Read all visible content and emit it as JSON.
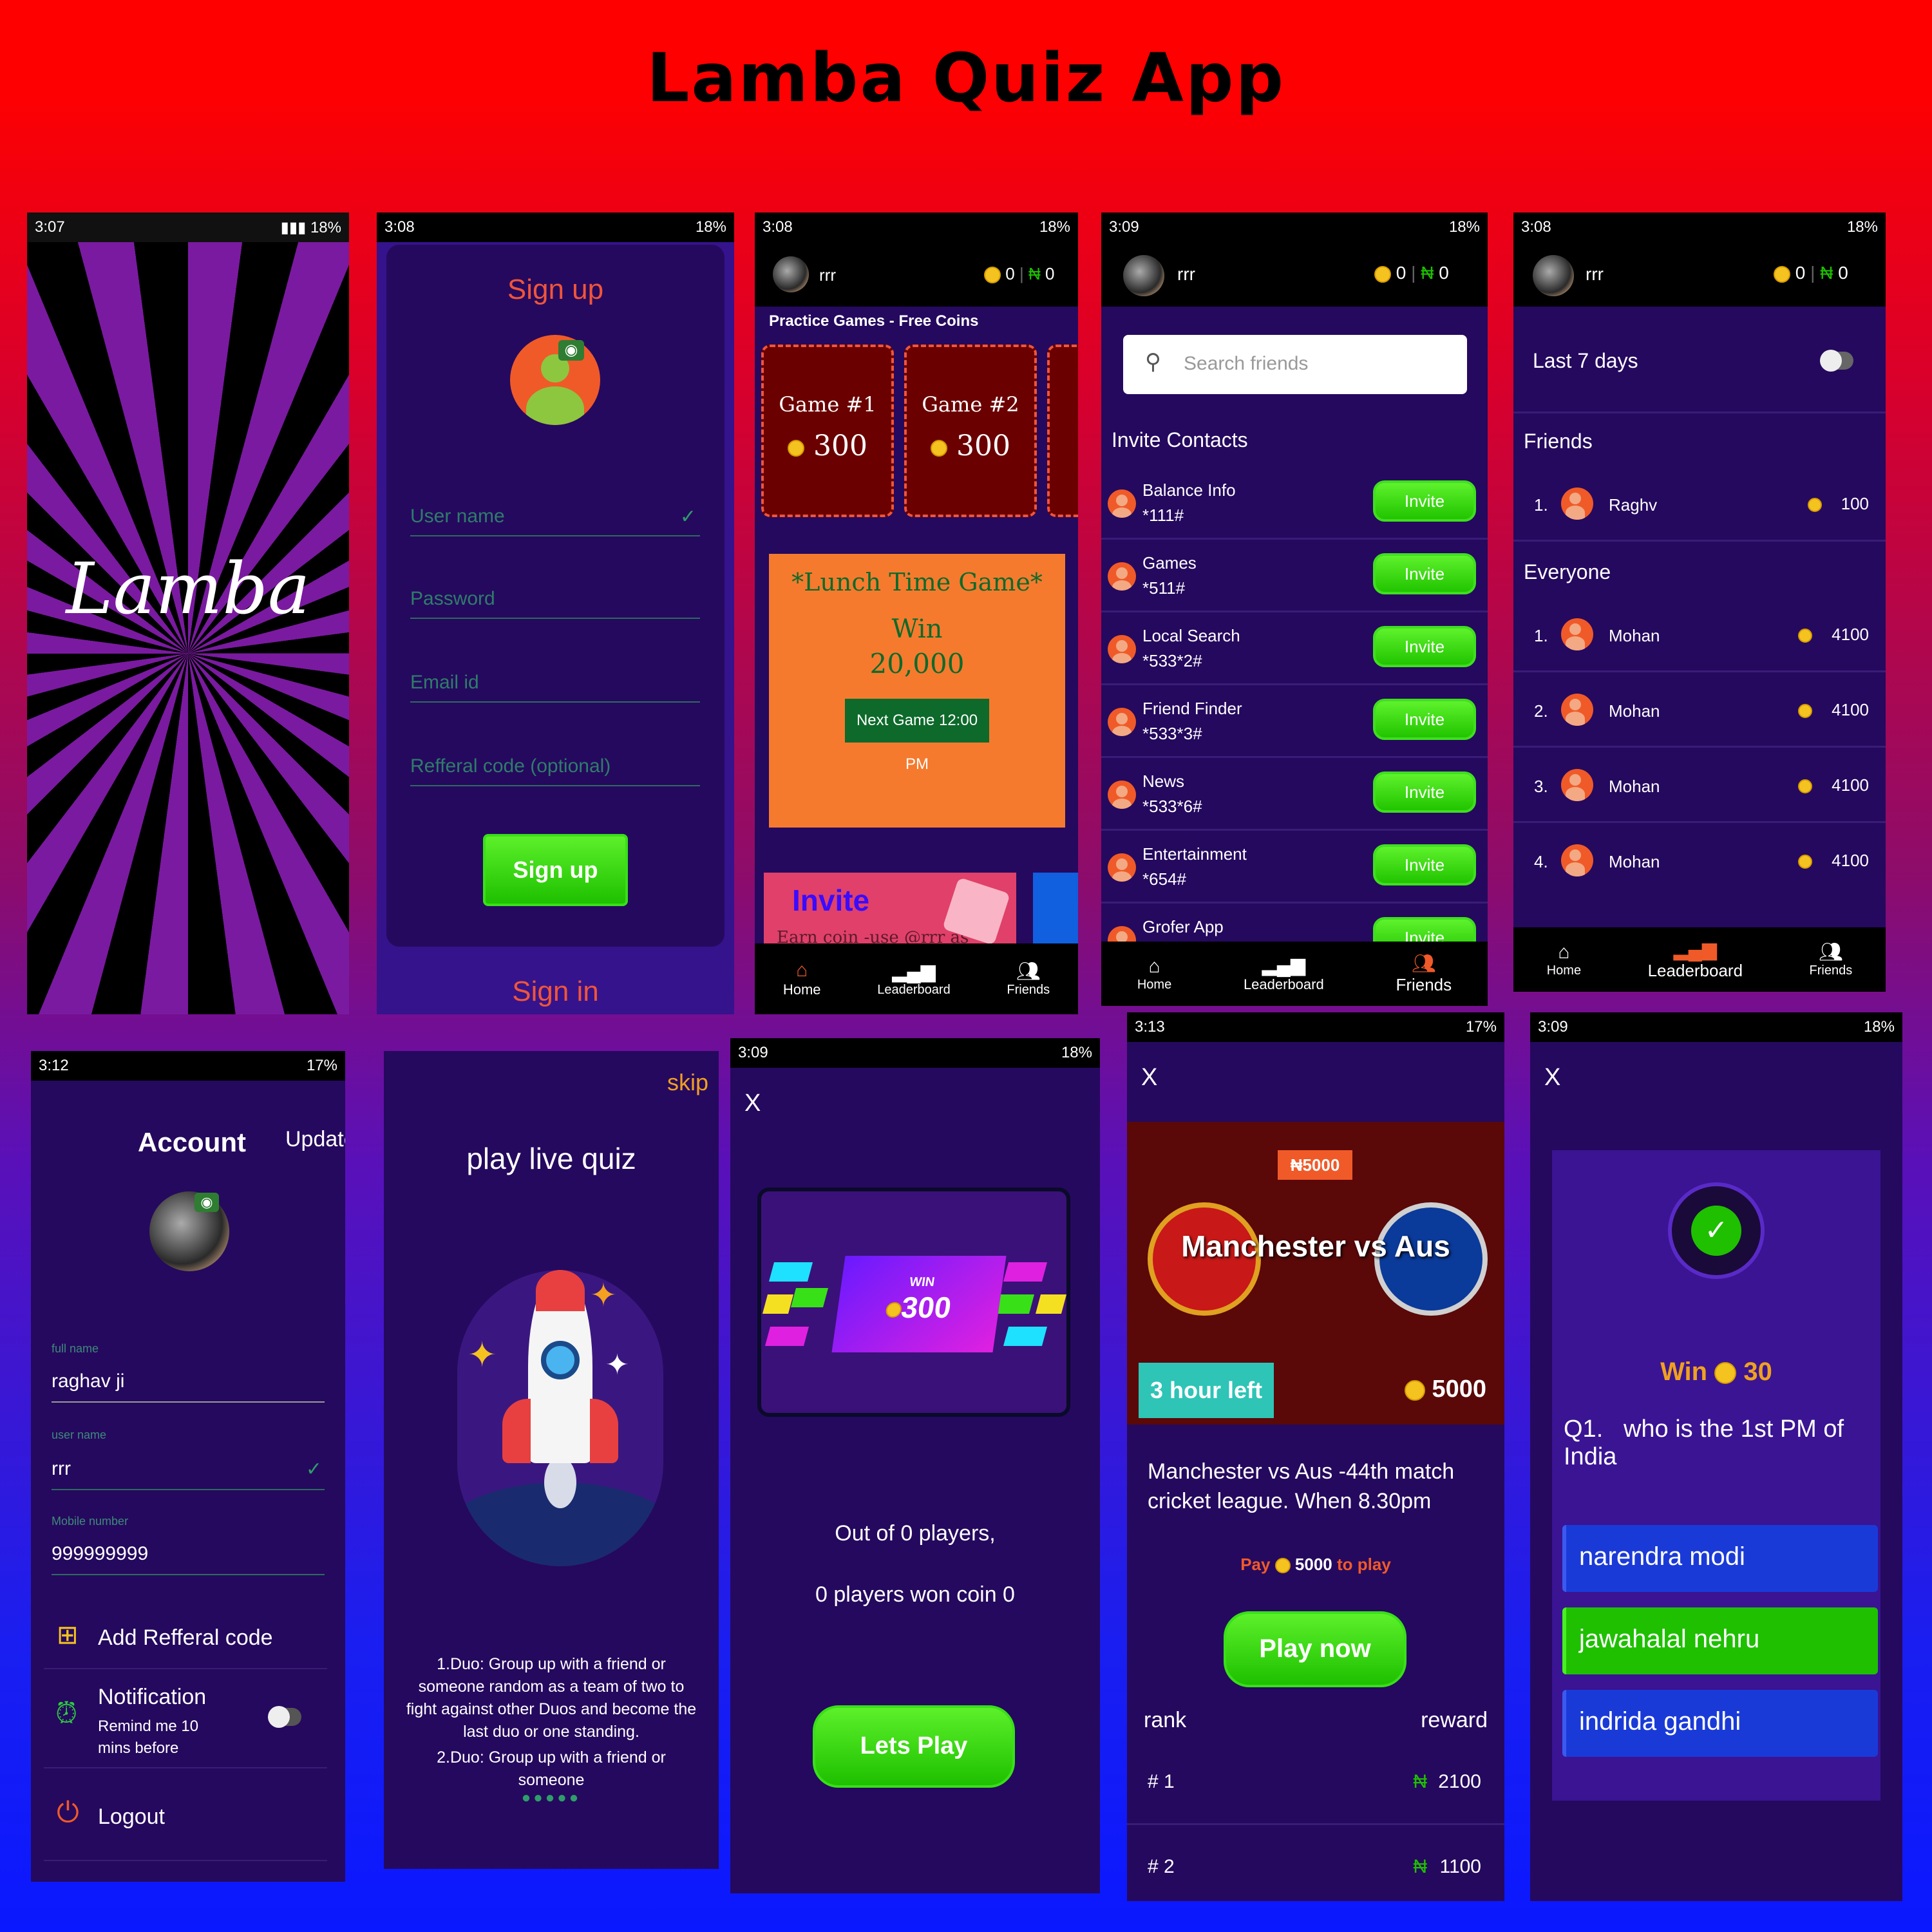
{
  "title": "Lamba Quiz App",
  "splash": {
    "time": "3:07",
    "battery": "18%",
    "logo": "Lamba"
  },
  "signup": {
    "time": "3:08",
    "battery": "18%",
    "heading": "Sign up",
    "username_ph": "User name",
    "password_ph": "Password",
    "email_ph": "Email id",
    "referral_ph": "Refferal code (optional)",
    "button": "Sign up",
    "signin": "Sign in"
  },
  "home": {
    "time": "3:08",
    "battery": "18%",
    "user": "rrr",
    "coins": "0",
    "naira": "0",
    "section": "Practice Games - Free Coins",
    "games": [
      {
        "name": "Game #1",
        "prize": "300"
      },
      {
        "name": "Game #2",
        "prize": "300"
      }
    ],
    "lunch": {
      "title": "*Lunch Time Game*",
      "win": "Win",
      "amount": "20,000",
      "next": "Next Game 12:00 PM"
    },
    "invite": {
      "title": "Invite",
      "sub": "Earn coin -use @rrr as"
    },
    "nav": [
      "Home",
      "Leaderboard",
      "Friends"
    ]
  },
  "friends": {
    "time": "3:09",
    "battery": "18%",
    "user": "rrr",
    "coins": "0",
    "naira": "0",
    "search_ph": "Search friends",
    "section": "Invite Contacts",
    "invite_label": "Invite",
    "contacts": [
      {
        "name": "Balance Info",
        "num": "*111#"
      },
      {
        "name": "Games",
        "num": "*511#"
      },
      {
        "name": "Local Search",
        "num": "*533*2#"
      },
      {
        "name": "Friend Finder",
        "num": "*533*3#"
      },
      {
        "name": "News",
        "num": "*533*6#"
      },
      {
        "name": "Entertainment",
        "num": "*654#"
      },
      {
        "name": "Grofer App",
        "num": ""
      }
    ],
    "nav": [
      "Home",
      "Leaderboard",
      "Friends"
    ]
  },
  "leaderboard": {
    "time": "3:08",
    "battery": "18%",
    "user": "rrr",
    "coins": "0",
    "naira": "0",
    "filter": "Last 7 days",
    "friends_title": "Friends",
    "friends": [
      {
        "rank": "1.",
        "name": "Raghv",
        "score": "100"
      }
    ],
    "everyone_title": "Everyone",
    "everyone": [
      {
        "rank": "1.",
        "name": "Mohan",
        "score": "4100"
      },
      {
        "rank": "2.",
        "name": "Mohan",
        "score": "4100"
      },
      {
        "rank": "3.",
        "name": "Mohan",
        "score": "4100"
      },
      {
        "rank": "4.",
        "name": "Mohan",
        "score": "4100"
      }
    ],
    "nav": [
      "Home",
      "Leaderboard",
      "Friends"
    ]
  },
  "account": {
    "time": "3:12",
    "battery": "17%",
    "title": "Account",
    "update": "Update",
    "fullname_label": "full name",
    "fullname": "raghav ji",
    "username_label": "user name",
    "username": "rrr",
    "mobile_label": "Mobile number",
    "mobile": "999999999",
    "referral": "Add Refferal code",
    "notification": "Notification",
    "remind": "Remind me 10 mins before",
    "logout": "Logout"
  },
  "onboarding": {
    "skip": "skip",
    "title": "play live quiz",
    "text1": "1.Duo: Group up with a friend or someone random as a team of two to fight against other Duos and become the last duo or one standing.",
    "text2": "2.Duo: Group up with a friend or someone"
  },
  "result": {
    "time": "3:09",
    "battery": "18%",
    "close": "X",
    "win": "WIN",
    "amount": "300",
    "line1": "Out of 0 players,",
    "line2": "0 players won coin 0",
    "button": "Lets Play"
  },
  "match": {
    "time": "3:13",
    "battery": "17%",
    "close": "X",
    "prize_badge": "₦5000",
    "title": "Manchester vs Aus",
    "time_left": "3 hour left",
    "entry": "5000",
    "desc": "Manchester vs Aus -44th match cricket league. When 8.30pm",
    "pay": "Pay",
    "pay_amount": "5000",
    "to_play": "to play",
    "button": "Play now",
    "rank_label": "rank",
    "reward_label": "reward",
    "rewards": [
      {
        "rank": "# 1",
        "amount": "2100"
      },
      {
        "rank": "# 2",
        "amount": "1100"
      }
    ]
  },
  "quiz": {
    "time": "3:09",
    "battery": "18%",
    "close": "X",
    "win": "Win",
    "win_amount": "30",
    "qnum": "Q1.",
    "question": "who is the 1st PM of India",
    "answers": [
      "narendra modi",
      "jawahalal nehru",
      "indrida gandhi"
    ]
  },
  "colors": {
    "bg_purple": "#25095e",
    "green": "#1ec000",
    "orange": "#f05a28",
    "gold": "#f4c320"
  }
}
